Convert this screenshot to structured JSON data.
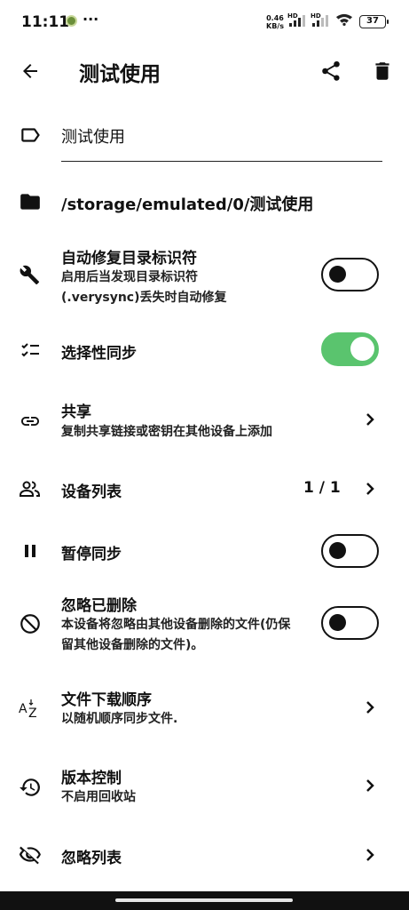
{
  "status_bar": {
    "time": "11:11",
    "dots": "···",
    "speed_value": "0.46",
    "speed_unit": "KB/s",
    "hd1": "HD",
    "hd2": "HD",
    "battery": "37"
  },
  "app_bar": {
    "title": "测试使用"
  },
  "folder": {
    "label_value": "测试使用",
    "path": "/storage/emulated/0/测试使用"
  },
  "settings": {
    "auto_repair": {
      "title": "自动修复目录标识符",
      "subtitle": "启用后当发现目录标识符(.verysync)丢失时自动修复",
      "enabled": false
    },
    "selective_sync": {
      "title": "选择性同步",
      "enabled": true
    },
    "share": {
      "title": "共享",
      "subtitle": "复制共享链接或密钥在其他设备上添加"
    },
    "device_list": {
      "title": "设备列表",
      "count": "1 / 1"
    },
    "pause_sync": {
      "title": "暂停同步",
      "enabled": false
    },
    "ignore_deleted": {
      "title": "忽略已删除",
      "subtitle": "本设备将忽略由其他设备删除的文件(仍保留其他设备删除的文件)。",
      "enabled": false
    },
    "download_order": {
      "title": "文件下载顺序",
      "subtitle": "以随机顺序同步文件."
    },
    "versioning": {
      "title": "版本控制",
      "subtitle": "不启用回收站"
    },
    "ignore_list": {
      "title": "忽略列表"
    }
  },
  "colors": {
    "accent_green": "#5ac46e",
    "text": "#111111"
  }
}
